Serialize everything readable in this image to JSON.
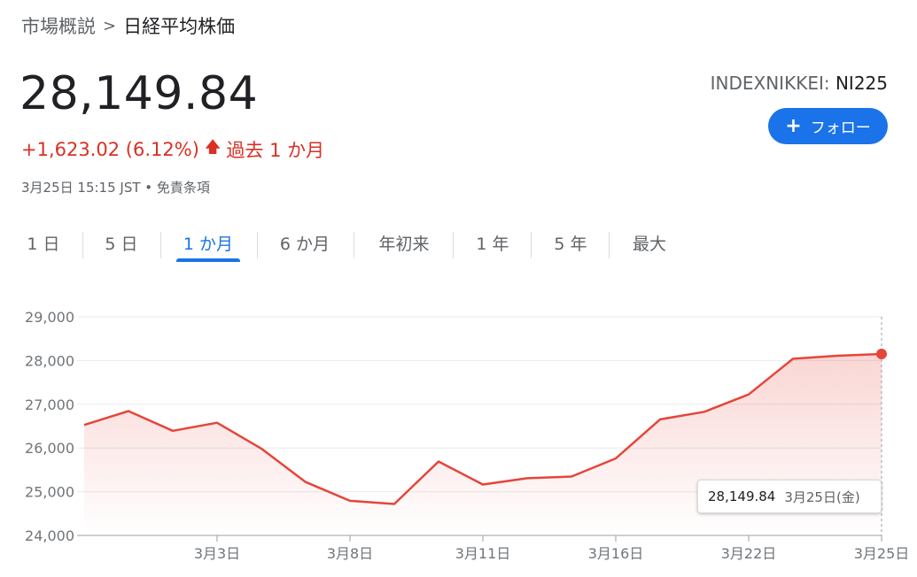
{
  "breadcrumb": {
    "parent": "市場概説",
    "separator": ">",
    "current": "日経平均株価"
  },
  "quote": {
    "price": "28,149.84",
    "change": "+1,623.02 (6.12%)",
    "period": "過去 1 か月",
    "timestamp": "3月25日 15:15 JST • 免責条項",
    "ticker_prefix": "INDEXNIKKEI:",
    "ticker_code": "NI225"
  },
  "follow_button": {
    "icon": "plus-icon",
    "label": "フォロー",
    "color": "#1a73e8"
  },
  "tabs": [
    {
      "label": "1 日",
      "active": false
    },
    {
      "label": "5 日",
      "active": false
    },
    {
      "label": "1 か月",
      "active": true
    },
    {
      "label": "6 か月",
      "active": false
    },
    {
      "label": "年初来",
      "active": false
    },
    {
      "label": "1 年",
      "active": false
    },
    {
      "label": "5 年",
      "active": false
    },
    {
      "label": "最大",
      "active": false
    }
  ],
  "tooltip": {
    "value": "28,149.84",
    "date": "3月25日(金)"
  },
  "colors": {
    "line": "#e5453a",
    "positive": "#d93025",
    "accent": "#1a73e8"
  },
  "chart_data": {
    "type": "area",
    "y_ticks": [
      "29,000",
      "28,000",
      "27,000",
      "26,000",
      "25,000",
      "24,000"
    ],
    "x_ticks": [
      "3月3日",
      "3月8日",
      "3月11日",
      "3月16日",
      "3月22日",
      "3月25日"
    ],
    "x_tick_index": [
      3,
      6,
      9,
      12,
      15,
      18
    ],
    "ylim": [
      24000,
      29000
    ],
    "grid": true,
    "values": [
      26527,
      26844,
      26393,
      26577,
      25985,
      25221,
      24791,
      24718,
      25690,
      25163,
      25308,
      25346,
      25762,
      26653,
      26827,
      27224,
      28040,
      28110,
      28149.84
    ]
  }
}
